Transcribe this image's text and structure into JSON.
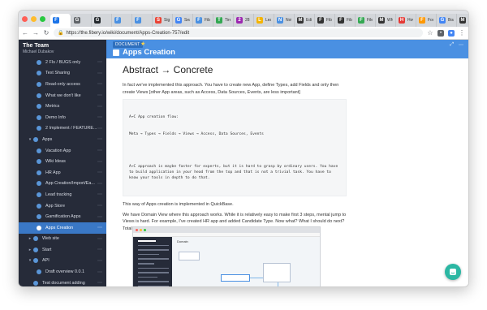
{
  "browser": {
    "tabs": [
      {
        "title": "",
        "color": "#1a73e8",
        "glyph": "F"
      },
      {
        "title": "",
        "color": "#5f6368",
        "glyph": "G"
      },
      {
        "title": "",
        "color": "#24292e",
        "glyph": "G"
      },
      {
        "title": "",
        "color": "#4a90e2",
        "glyph": "F"
      },
      {
        "title": "",
        "color": "#4a90e2",
        "glyph": "F"
      },
      {
        "title": "Sign",
        "color": "#ea4335",
        "glyph": "S"
      },
      {
        "title": "Sear",
        "color": "#4285f4",
        "glyph": "G"
      },
      {
        "title": "Fiber",
        "color": "#4a90e2",
        "glyph": "F"
      },
      {
        "title": "Tiret",
        "color": "#34a853",
        "glyph": "T"
      },
      {
        "title": "28 ·",
        "color": "#9c27b0",
        "glyph": "2"
      },
      {
        "title": "Learn",
        "color": "#f4b400",
        "glyph": "L"
      },
      {
        "title": "Note",
        "color": "#4a90e2",
        "glyph": "N"
      },
      {
        "title": "Editi",
        "color": "#333333",
        "glyph": "M"
      },
      {
        "title": "Fiber",
        "color": "#333333",
        "glyph": "F"
      },
      {
        "title": "Fiber",
        "color": "#333333",
        "glyph": "F"
      },
      {
        "title": "File",
        "color": "#34a853",
        "glyph": "F"
      },
      {
        "title": "Why",
        "color": "#333333",
        "glyph": "M"
      },
      {
        "title": "How",
        "color": "#e53935",
        "glyph": "H"
      },
      {
        "title": "Four",
        "color": "#ff9800",
        "glyph": "F"
      },
      {
        "title": "Boar",
        "color": "#4285f4",
        "glyph": "G"
      },
      {
        "title": "Use",
        "color": "#333333",
        "glyph": "M"
      }
    ],
    "url": "https://the.fibery.io/wiki/document/Apps-Creation-757/edit"
  },
  "sidebar": {
    "team": "The Team",
    "user": "Michael Dubakov",
    "items": [
      {
        "label": "2 FIs / BUGS only",
        "level": 1,
        "arrow": "",
        "active": false
      },
      {
        "label": "Text Sharing",
        "level": 1,
        "arrow": "",
        "active": false
      },
      {
        "label": "Read-only access",
        "level": 1,
        "arrow": "",
        "active": false
      },
      {
        "label": "What we don't like",
        "level": 1,
        "arrow": "",
        "active": false
      },
      {
        "label": "Metrics",
        "level": 1,
        "arrow": "",
        "active": false
      },
      {
        "label": "Demo Info",
        "level": 1,
        "arrow": "",
        "active": false
      },
      {
        "label": "2 Implement / FEATURE...",
        "level": 1,
        "arrow": "",
        "active": false
      },
      {
        "label": "Apps",
        "level": 0,
        "arrow": "▾",
        "active": false
      },
      {
        "label": "Vacation App",
        "level": 1,
        "arrow": "",
        "active": false
      },
      {
        "label": "Wiki Ideas",
        "level": 1,
        "arrow": "",
        "active": false
      },
      {
        "label": "HR App",
        "level": 1,
        "arrow": "",
        "active": false
      },
      {
        "label": "App Creation/Import/Ea...",
        "level": 1,
        "arrow": "",
        "active": false
      },
      {
        "label": "Lead tracking",
        "level": 1,
        "arrow": "",
        "active": false
      },
      {
        "label": "App Store",
        "level": 1,
        "arrow": "",
        "active": false
      },
      {
        "label": "Gamification Apps",
        "level": 1,
        "arrow": "",
        "active": false
      },
      {
        "label": "Apps Creation",
        "level": 1,
        "arrow": "",
        "active": true
      },
      {
        "label": "Web site",
        "level": 0,
        "arrow": "▸",
        "active": false
      },
      {
        "label": "Start",
        "level": 0,
        "arrow": "▸",
        "active": false
      },
      {
        "label": "API",
        "level": 0,
        "arrow": "▾",
        "active": false
      },
      {
        "label": "Draft overview 0.0.1",
        "level": 1,
        "arrow": "",
        "active": false
      },
      {
        "label": "Test document adding",
        "level": 0,
        "arrow": "",
        "active": false
      }
    ]
  },
  "doc": {
    "badge": "DOCUMENT",
    "title": "Apps Creation",
    "heading": "Abstract → Concrete",
    "para1": "In fact we've implemented this approach. You have to create new App, define Types, add Fields and only then create Views [other App areas, such as Access, Data Sources, Events, are less important]",
    "code_line1": "A→C App creation flow:",
    "code_line2": "Meta → Types → Fields → Views → Access, Data Sources, Events",
    "code_line3": "A→C approach is maybe faster for experts, but it is hard to grasp by ordinary users. You have to build application in your head from the top and that is not a trivial task. You have to know your tools in depth to do that.",
    "para2": "This way of Apps creation is implemented in QuickBase.",
    "para3": "We have Domain View where this approach works. While it is relatively easy to make first 3 steps, mental jump to Views is hard. For example, I've created HR app and added Candidate Type. Now what? What I should do next? Totally unclear.",
    "embed_title": "Domain"
  },
  "colors": {
    "sidebar_bg": "#262b39",
    "accent": "#4a90e2",
    "active_item": "#3a78c6",
    "fab": "#2bb7a3"
  }
}
